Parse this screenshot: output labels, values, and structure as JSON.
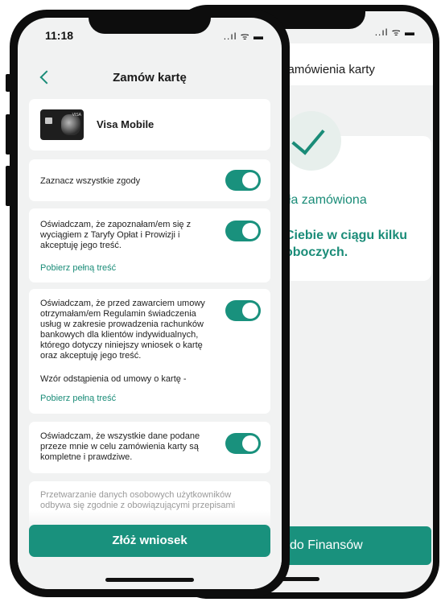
{
  "status": {
    "time": "11:18",
    "icons": "..ıl ᯤ ▬"
  },
  "back_screen": {
    "title": "zamówienia karty",
    "ok_title": "ała zamówiona",
    "ok_sub": "Ciebie w ciągu kilku oboczych.",
    "cta": "do Finansów"
  },
  "header": {
    "title": "Zamów kartę"
  },
  "card": {
    "name": "Visa Mobile",
    "brand": "VISA"
  },
  "consents": {
    "select_all": "Zaznacz wszystkie zgody",
    "c1_text": "Oświadczam, że zapoznałam/em się z wyciągiem z Taryfy Opłat i Prowizji i akceptuję jego treść.",
    "c1_link": "Pobierz pełną treść",
    "c2_text": "Oświadczam, że przed zawarciem umowy otrzymałam/em Regulamin świadczenia usług w zakresie prowadzenia rachunków bankowych dla klientów indywidualnych, którego dotyczy niniejszy wniosek o kartę oraz akceptuję jego treść.",
    "c2_withdraw": "Wzór odstąpienia od umowy o kartę -",
    "c2_link": "Pobierz pełną treść",
    "c3_text": "Oświadczam, że wszystkie dane podane przeze mnie w celu zamówienia karty są kompletne i prawdziwe.",
    "info_text": "Przetwarzanie danych osobowych użytkowników odbywa się zgodnie z obowiązującymi przepisami"
  },
  "submit": {
    "label": "Złóż wniosek"
  },
  "colors": {
    "accent": "#19917d",
    "link": "#1a8c78",
    "background": "#f1f2f2"
  },
  "toggles": {
    "select_all": true,
    "c1": true,
    "c2": true,
    "c3": true
  }
}
